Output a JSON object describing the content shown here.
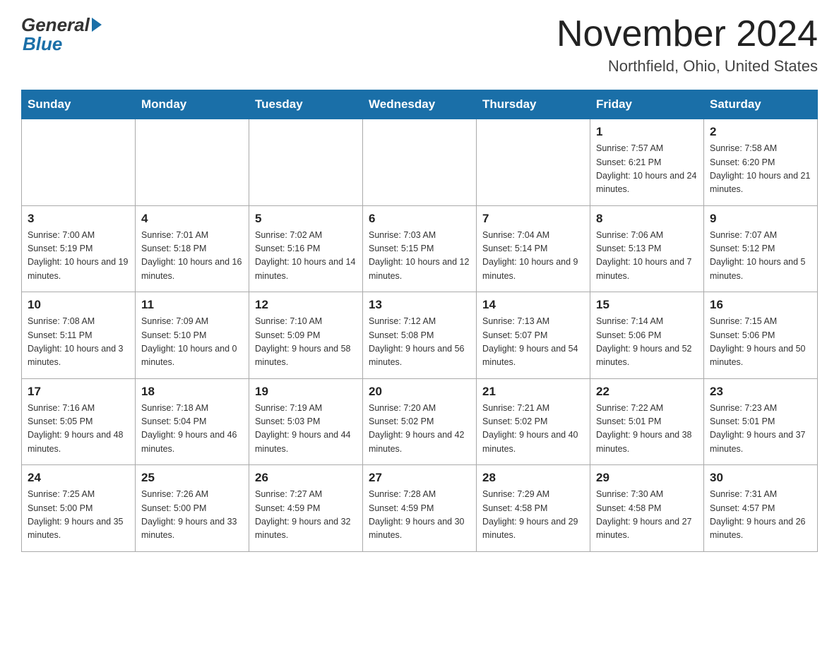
{
  "header": {
    "logo_general": "General",
    "logo_blue": "Blue",
    "month_title": "November 2024",
    "location": "Northfield, Ohio, United States"
  },
  "days_of_week": [
    "Sunday",
    "Monday",
    "Tuesday",
    "Wednesday",
    "Thursday",
    "Friday",
    "Saturday"
  ],
  "weeks": [
    [
      {
        "day": "",
        "info": ""
      },
      {
        "day": "",
        "info": ""
      },
      {
        "day": "",
        "info": ""
      },
      {
        "day": "",
        "info": ""
      },
      {
        "day": "",
        "info": ""
      },
      {
        "day": "1",
        "info": "Sunrise: 7:57 AM\nSunset: 6:21 PM\nDaylight: 10 hours and 24 minutes."
      },
      {
        "day": "2",
        "info": "Sunrise: 7:58 AM\nSunset: 6:20 PM\nDaylight: 10 hours and 21 minutes."
      }
    ],
    [
      {
        "day": "3",
        "info": "Sunrise: 7:00 AM\nSunset: 5:19 PM\nDaylight: 10 hours and 19 minutes."
      },
      {
        "day": "4",
        "info": "Sunrise: 7:01 AM\nSunset: 5:18 PM\nDaylight: 10 hours and 16 minutes."
      },
      {
        "day": "5",
        "info": "Sunrise: 7:02 AM\nSunset: 5:16 PM\nDaylight: 10 hours and 14 minutes."
      },
      {
        "day": "6",
        "info": "Sunrise: 7:03 AM\nSunset: 5:15 PM\nDaylight: 10 hours and 12 minutes."
      },
      {
        "day": "7",
        "info": "Sunrise: 7:04 AM\nSunset: 5:14 PM\nDaylight: 10 hours and 9 minutes."
      },
      {
        "day": "8",
        "info": "Sunrise: 7:06 AM\nSunset: 5:13 PM\nDaylight: 10 hours and 7 minutes."
      },
      {
        "day": "9",
        "info": "Sunrise: 7:07 AM\nSunset: 5:12 PM\nDaylight: 10 hours and 5 minutes."
      }
    ],
    [
      {
        "day": "10",
        "info": "Sunrise: 7:08 AM\nSunset: 5:11 PM\nDaylight: 10 hours and 3 minutes."
      },
      {
        "day": "11",
        "info": "Sunrise: 7:09 AM\nSunset: 5:10 PM\nDaylight: 10 hours and 0 minutes."
      },
      {
        "day": "12",
        "info": "Sunrise: 7:10 AM\nSunset: 5:09 PM\nDaylight: 9 hours and 58 minutes."
      },
      {
        "day": "13",
        "info": "Sunrise: 7:12 AM\nSunset: 5:08 PM\nDaylight: 9 hours and 56 minutes."
      },
      {
        "day": "14",
        "info": "Sunrise: 7:13 AM\nSunset: 5:07 PM\nDaylight: 9 hours and 54 minutes."
      },
      {
        "day": "15",
        "info": "Sunrise: 7:14 AM\nSunset: 5:06 PM\nDaylight: 9 hours and 52 minutes."
      },
      {
        "day": "16",
        "info": "Sunrise: 7:15 AM\nSunset: 5:06 PM\nDaylight: 9 hours and 50 minutes."
      }
    ],
    [
      {
        "day": "17",
        "info": "Sunrise: 7:16 AM\nSunset: 5:05 PM\nDaylight: 9 hours and 48 minutes."
      },
      {
        "day": "18",
        "info": "Sunrise: 7:18 AM\nSunset: 5:04 PM\nDaylight: 9 hours and 46 minutes."
      },
      {
        "day": "19",
        "info": "Sunrise: 7:19 AM\nSunset: 5:03 PM\nDaylight: 9 hours and 44 minutes."
      },
      {
        "day": "20",
        "info": "Sunrise: 7:20 AM\nSunset: 5:02 PM\nDaylight: 9 hours and 42 minutes."
      },
      {
        "day": "21",
        "info": "Sunrise: 7:21 AM\nSunset: 5:02 PM\nDaylight: 9 hours and 40 minutes."
      },
      {
        "day": "22",
        "info": "Sunrise: 7:22 AM\nSunset: 5:01 PM\nDaylight: 9 hours and 38 minutes."
      },
      {
        "day": "23",
        "info": "Sunrise: 7:23 AM\nSunset: 5:01 PM\nDaylight: 9 hours and 37 minutes."
      }
    ],
    [
      {
        "day": "24",
        "info": "Sunrise: 7:25 AM\nSunset: 5:00 PM\nDaylight: 9 hours and 35 minutes."
      },
      {
        "day": "25",
        "info": "Sunrise: 7:26 AM\nSunset: 5:00 PM\nDaylight: 9 hours and 33 minutes."
      },
      {
        "day": "26",
        "info": "Sunrise: 7:27 AM\nSunset: 4:59 PM\nDaylight: 9 hours and 32 minutes."
      },
      {
        "day": "27",
        "info": "Sunrise: 7:28 AM\nSunset: 4:59 PM\nDaylight: 9 hours and 30 minutes."
      },
      {
        "day": "28",
        "info": "Sunrise: 7:29 AM\nSunset: 4:58 PM\nDaylight: 9 hours and 29 minutes."
      },
      {
        "day": "29",
        "info": "Sunrise: 7:30 AM\nSunset: 4:58 PM\nDaylight: 9 hours and 27 minutes."
      },
      {
        "day": "30",
        "info": "Sunrise: 7:31 AM\nSunset: 4:57 PM\nDaylight: 9 hours and 26 minutes."
      }
    ]
  ]
}
